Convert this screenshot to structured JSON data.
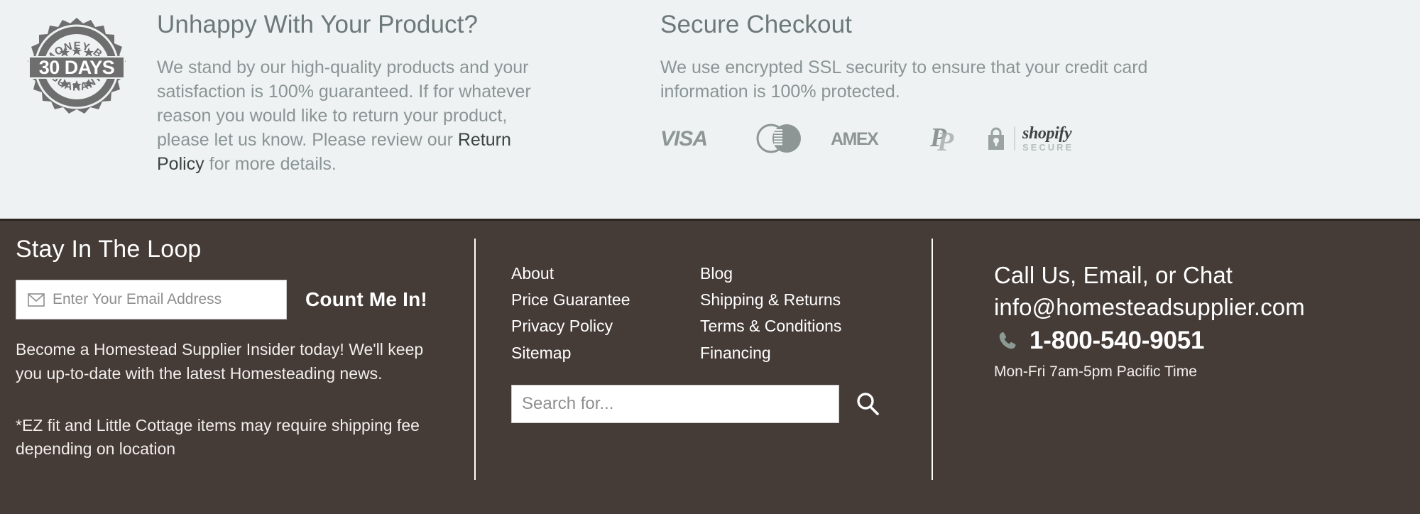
{
  "trust": {
    "guarantee": {
      "badge": {
        "top_text": "MONEY BACK",
        "main_text": "30 DAYS",
        "bottom_text": "GUARANTEE"
      },
      "heading": "Unhappy With Your Product?",
      "body_before": "We stand by our high-quality products and your satisfaction is 100% guaranteed. If for whatever reason you would like to return your product, please let us know. Please review our ",
      "link_label": "Return Policy",
      "body_after": " for more details."
    },
    "secure": {
      "heading": "Secure Checkout",
      "body": "We use encrypted SSL security to ensure that your credit card information is 100% protected.",
      "payment_icons": [
        {
          "name": "visa-icon",
          "label": "VISA"
        },
        {
          "name": "mastercard-icon",
          "label": "Mastercard"
        },
        {
          "name": "amex-icon",
          "label": "AMEX"
        },
        {
          "name": "paypal-icon",
          "label": "PayPal"
        }
      ],
      "shopify": {
        "word": "shopify",
        "sub": "SECURE"
      }
    }
  },
  "footer": {
    "newsletter": {
      "title": "Stay In The Loop",
      "email_placeholder": "Enter Your Email Address",
      "email_value": "",
      "submit_label": "Count Me In!",
      "paragraph_1": "Become a Homestead Supplier Insider today! We'll keep you up-to-date with the latest Homesteading news.",
      "paragraph_2": "*EZ fit and Little Cottage items may require shipping fee depending on location"
    },
    "links": {
      "column_1": [
        "About",
        "Price Guarantee",
        "Privacy Policy",
        "Sitemap"
      ],
      "column_2": [
        "Blog",
        "Shipping & Returns",
        "Terms & Conditions",
        "Financing"
      ]
    },
    "search": {
      "placeholder": "Search for...",
      "value": ""
    },
    "contact": {
      "heading": "Call Us, Email, or Chat",
      "email": "info@homesteadsupplier.com",
      "phone": "1-800-540-9051",
      "hours": "Mon-Fri 7am-5pm Pacific Time"
    }
  },
  "colors": {
    "trust_bg": "#eef2f2",
    "footer_bg": "#453b37",
    "muted_text": "#8b9494",
    "heading_text": "#6d7878",
    "white": "#ffffff"
  }
}
